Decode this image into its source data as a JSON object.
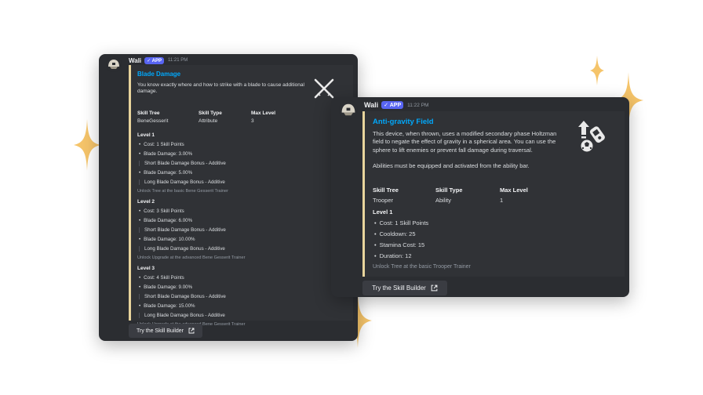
{
  "colors": {
    "background": "#ffffff",
    "card": "#2b2d31",
    "embed_accent": "#e8d49c",
    "title_link": "#00a8fc",
    "app_badge": "#5865f2",
    "sparkle": "#f5c46a"
  },
  "card1": {
    "username": "Wali",
    "app_badge": "✓ APP",
    "timestamp": "11:21 PM",
    "embed": {
      "title": "Blade Damage",
      "description": "You know exactly where and how to strike with a blade to cause additional damage.",
      "thumbnail_icon": "crossed-blades-icon",
      "fields": [
        {
          "name": "Skill Tree",
          "value": "BeneGesserit"
        },
        {
          "name": "Skill Type",
          "value": "Attribute"
        },
        {
          "name": "Max Level",
          "value": "3"
        }
      ],
      "levels": [
        {
          "title": "Level 1",
          "cost": "Cost: 1 Skill Points",
          "blade_damage_a": "Blade Damage: 3.00%",
          "short_bonus": "Short Blade Damage Bonus - Additive",
          "blade_damage_b": "Blade Damage: 5.00%",
          "long_bonus": "Long Blade Damage Bonus - Additive",
          "unlock": "Unlock Tree at the basic Bene Gesserit Trainer"
        },
        {
          "title": "Level 2",
          "cost": "Cost: 3 Skill Points",
          "blade_damage_a": "Blade Damage: 6.00%",
          "short_bonus": "Short Blade Damage Bonus - Additive",
          "blade_damage_b": "Blade Damage: 10.00%",
          "long_bonus": "Long Blade Damage Bonus - Additive",
          "unlock": "Unlock Upgrade at the advanced Bene Gesserit Trainer"
        },
        {
          "title": "Level 3",
          "cost": "Cost: 4 Skill Points",
          "blade_damage_a": "Blade Damage: 9.00%",
          "short_bonus": "Short Blade Damage Bonus - Additive",
          "blade_damage_b": "Blade Damage: 15.00%",
          "long_bonus": "Long Blade Damage Bonus - Additive",
          "unlock": "Unlock Upgrade at the advanced Bene Gesserit Trainer"
        }
      ]
    },
    "button_label": "Try the Skill Builder",
    "button_icon": "external-link-icon"
  },
  "card2": {
    "username": "Wali",
    "app_badge": "✓ APP",
    "timestamp": "11:22 PM",
    "embed": {
      "title": "Anti-gravity Field",
      "description_1": "This device, when thrown, uses a modified secondary phase Holtzman field to negate the effect of gravity in a spherical area. You can use the sphere to lift enemies or prevent fall damage during traversal.",
      "description_2": "Abilities must be equipped and activated from the ability bar.",
      "thumbnail_icon": "anti-gravity-grenade-icon",
      "fields": [
        {
          "name": "Skill Tree",
          "value": "Trooper"
        },
        {
          "name": "Skill Type",
          "value": "Ability"
        },
        {
          "name": "Max Level",
          "value": "1"
        }
      ],
      "level": {
        "title": "Level 1",
        "bullets": [
          "Cost: 1 Skill Points",
          "Cooldown: 25",
          "Stamina Cost: 15",
          "Duration: 12"
        ],
        "unlock": "Unlock Tree at the basic Trooper Trainer"
      }
    },
    "button_label": "Try the Skill Builder",
    "button_icon": "external-link-icon"
  }
}
